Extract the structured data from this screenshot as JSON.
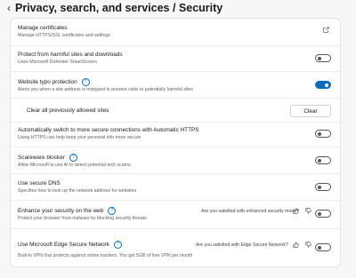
{
  "header": {
    "back_icon": "chevron-left-icon",
    "title": "Privacy, search, and services / Security"
  },
  "rows": {
    "manage_certificates": {
      "title": "Manage certificates",
      "description": "Manage HTTPS/SSL certificates and settings",
      "icon": "external-link-icon"
    },
    "smartscreen": {
      "title": "Protect from harmful sites and downloads",
      "description": "Uses Microsoft Defender SmartScreen",
      "toggle": "off"
    },
    "typo_protection": {
      "title": "Website typo protection",
      "description": "Alerts you when a site address is mistyped to prevent visits to potentially harmful sites",
      "toggle": "on"
    },
    "clear_allowed": {
      "title": "Clear all previously allowed sites",
      "button_label": "Clear"
    },
    "auto_https": {
      "title": "Automatically switch to more secure connections with Automatic HTTPS",
      "description": "Using HTTPS can help keep your personal info more secure",
      "toggle": "off"
    },
    "scareware": {
      "title": "Scareware blocker",
      "description": "Allow Microsoft to use AI to detect potential tech scams.",
      "toggle": "off"
    },
    "secure_dns": {
      "title": "Use secure DNS",
      "description": "Specifies how to look up the network address for websites",
      "toggle": "off"
    },
    "enhance_security": {
      "title": "Enhance your security on the web",
      "description": "Protect your browser from malware by blocking security threats",
      "survey": "Are you satisfied with enhanced security mode?",
      "toggle": "off"
    },
    "secure_network": {
      "title": "Use Microsoft Edge Secure Network",
      "description": "Built-in VPN that protects against online trackers. You get 5GB of free VPN per month",
      "survey": "Are you satisfied with Edge Secure Network?",
      "toggle": "off"
    }
  },
  "colors": {
    "accent": "#0f6cbd",
    "card_background": "#ffffff",
    "page_background": "#f7f7f7"
  }
}
